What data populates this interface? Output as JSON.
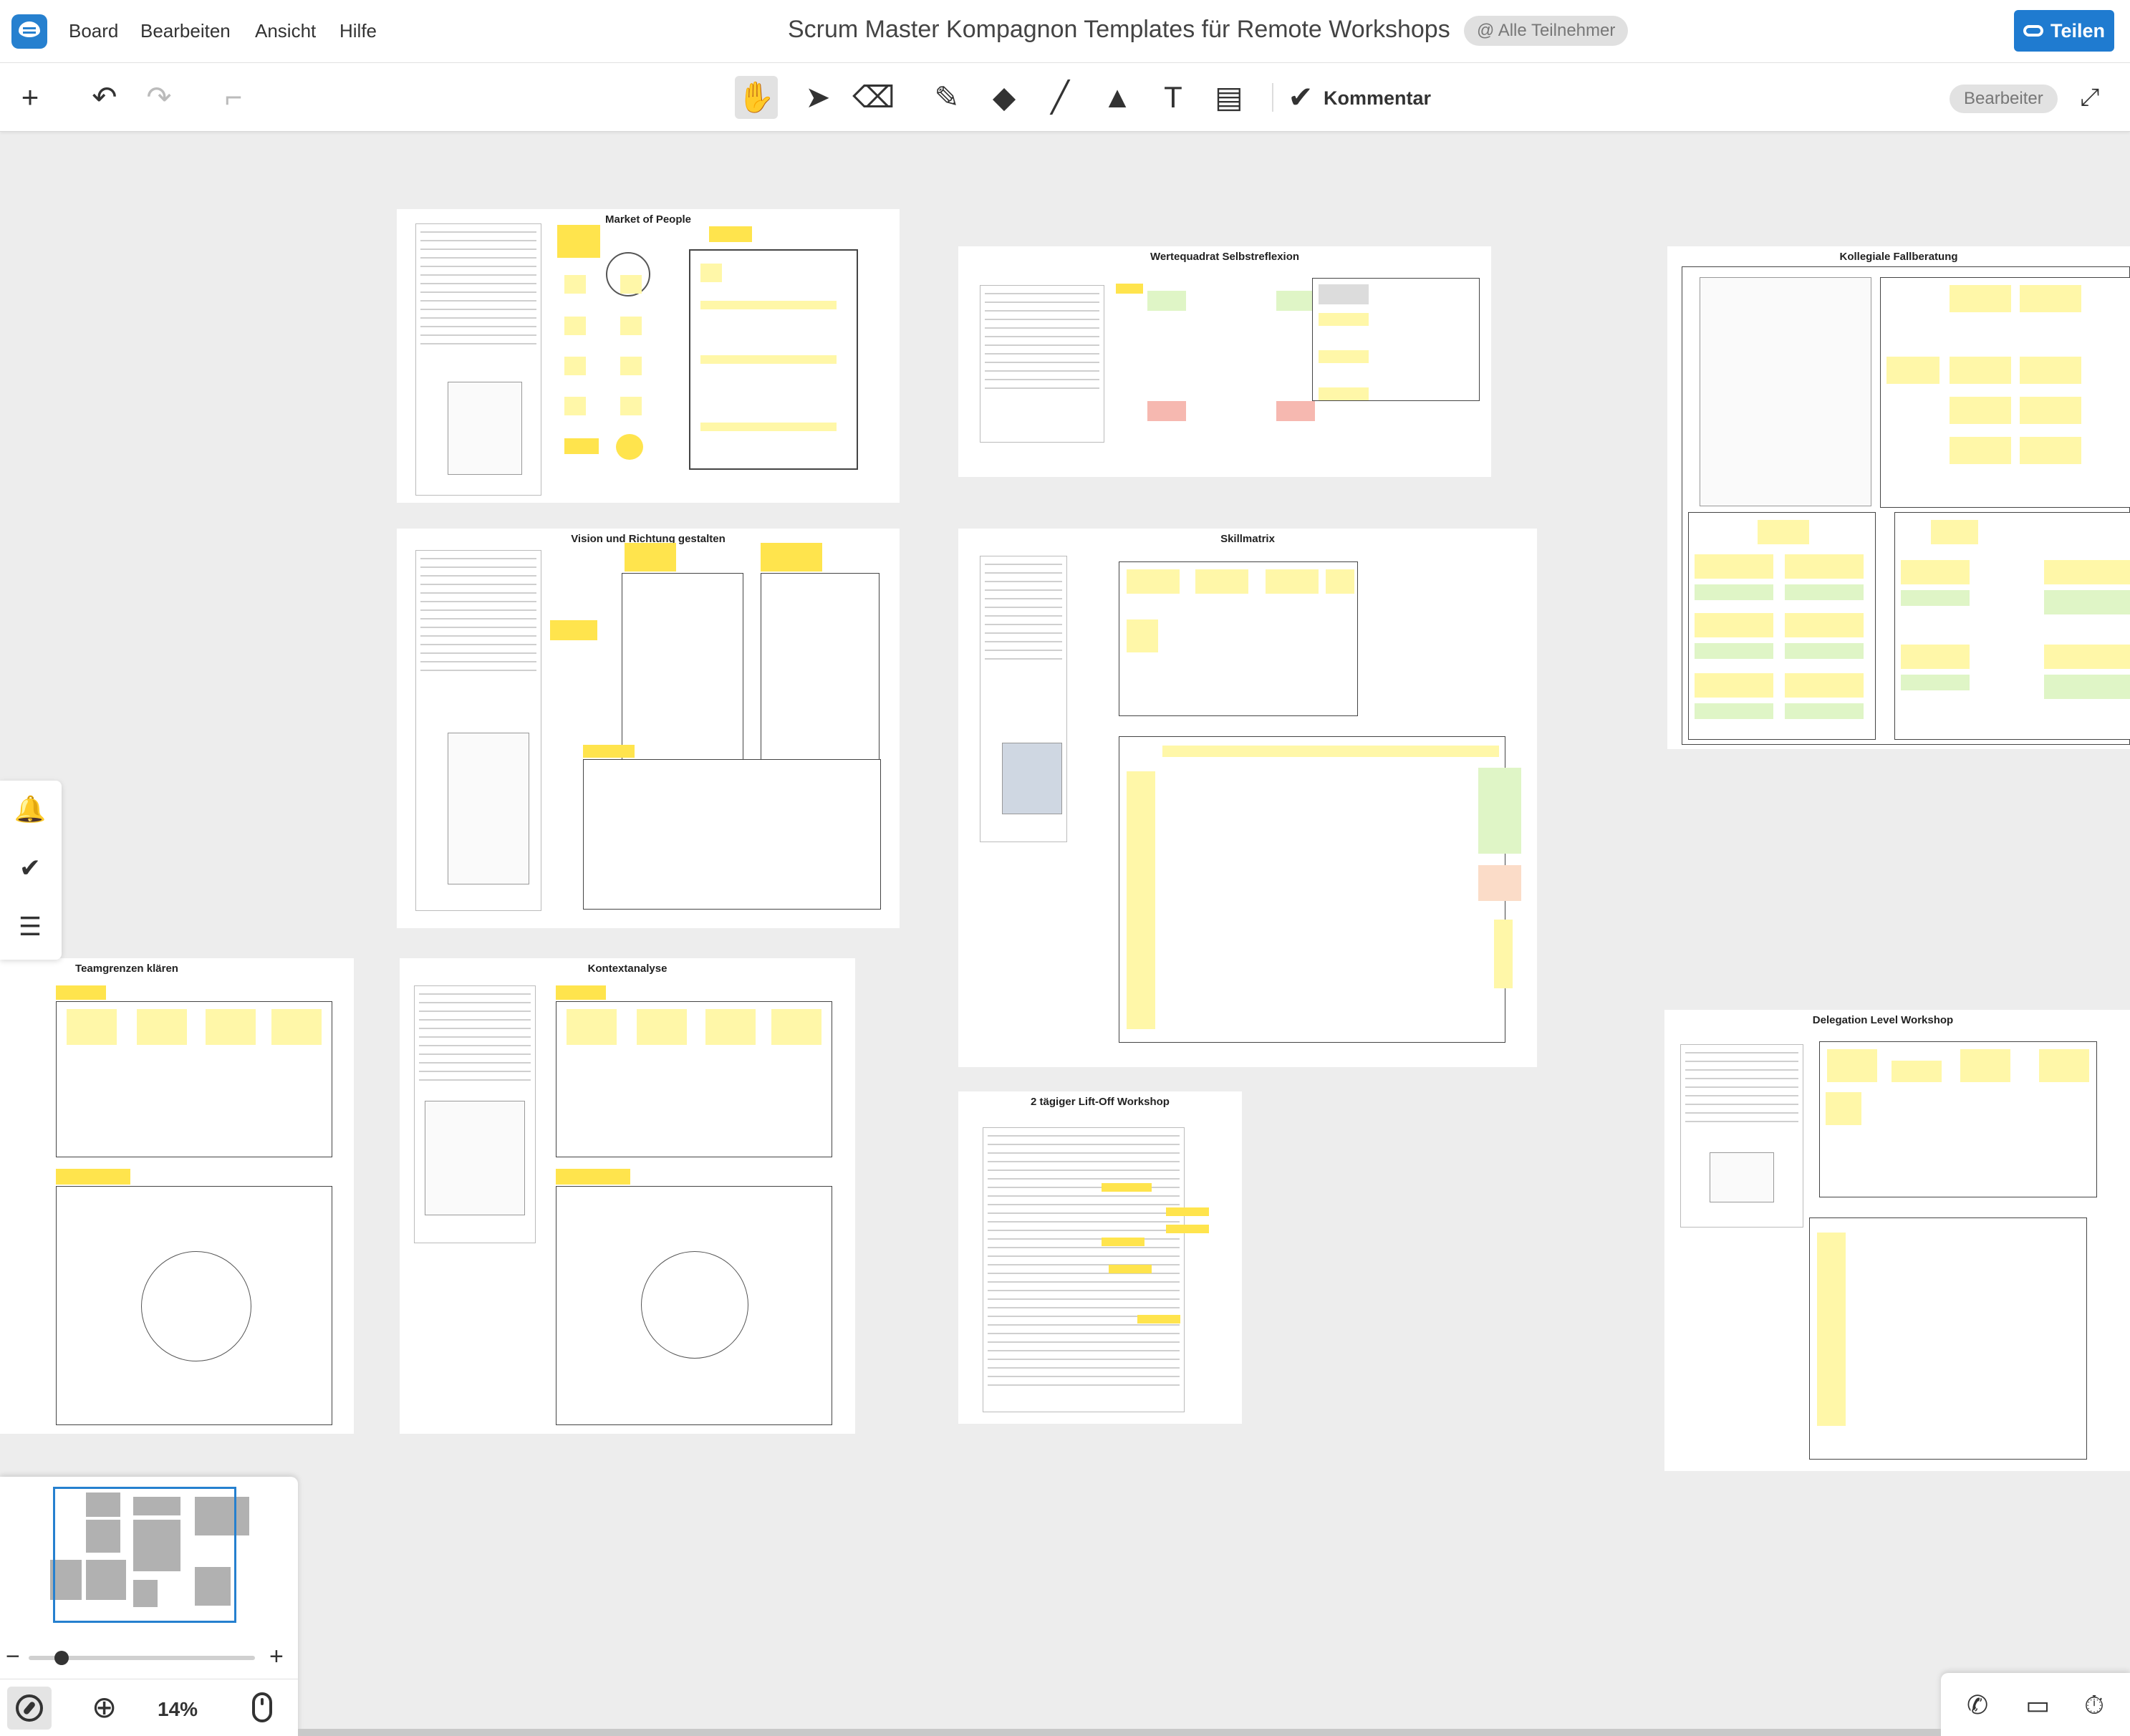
{
  "menubar": {
    "menus": [
      "Board",
      "Bearbeiten",
      "Ansicht",
      "Hilfe"
    ],
    "board_title": "Scrum Master Kompagnon Templates für Remote Workshops",
    "participants_label": "@ Alle Teilnehmer",
    "share_label": "Teilen"
  },
  "toolbar": {
    "tools": [
      {
        "name": "add-icon",
        "glyph": "+"
      },
      {
        "name": "undo-icon",
        "glyph": "↶"
      },
      {
        "name": "redo-icon",
        "glyph": "↷"
      },
      {
        "name": "format-paint-icon",
        "glyph": "🖌"
      },
      {
        "name": "hand-tool-icon",
        "glyph": "✋"
      },
      {
        "name": "select-cursor-icon",
        "glyph": "➤"
      },
      {
        "name": "eraser-icon",
        "glyph": "⌫"
      },
      {
        "name": "pen-icon",
        "glyph": "✎"
      },
      {
        "name": "marker-icon",
        "glyph": "◆"
      },
      {
        "name": "line-icon",
        "glyph": "╱"
      },
      {
        "name": "shapes-icon",
        "glyph": "▲"
      },
      {
        "name": "text-icon",
        "glyph": "T"
      },
      {
        "name": "sticky-note-icon",
        "glyph": "▤"
      },
      {
        "name": "comment-icon",
        "glyph": "✔"
      }
    ],
    "comment_label": "Kommentar",
    "edit_badge": "Bearbeiter"
  },
  "frames": {
    "market_of_people": "Market of People",
    "wertequadrat": "Wertequadrat Selbstreflexion",
    "kollegiale": "Kollegiale Fallberatung",
    "vision": "Vision und Richtung gestalten",
    "skillmatrix": "Skillmatrix",
    "teamgrenzen": "Teamgrenzen klären",
    "kontextanalyse": "Kontextanalyse",
    "liftoff": "2 tägiger Lift-Off Workshop",
    "delegation": "Delegation Level Workshop"
  },
  "zoom": {
    "level": "14%",
    "minus": "−",
    "plus": "+"
  }
}
